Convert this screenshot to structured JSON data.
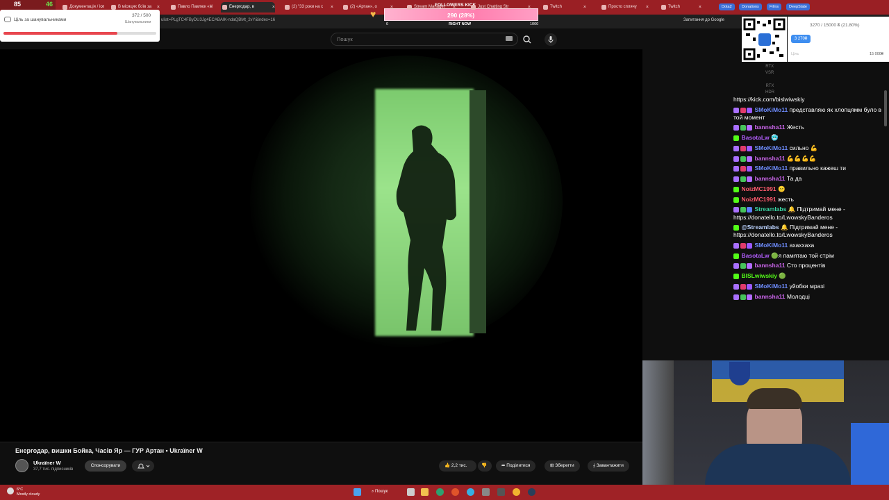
{
  "browser": {
    "tabs": [
      {
        "label": "Документація / історія"
      },
      {
        "label": "В місяцях боїв за"
      },
      {
        "label": "Павло Павлюк «Н"
      },
      {
        "label": "Енергодар, в"
      },
      {
        "label": "(2) \"33 роки на с"
      },
      {
        "label": "(2) «Артан», о"
      },
      {
        "label": "Stream Manager"
      },
      {
        "label": "Just Chatting Str"
      },
      {
        "label": "Twitch"
      },
      {
        "label": "Просто сплячу"
      },
      {
        "label": "Twitch"
      }
    ],
    "chips": [
      "Dota2",
      "Donations",
      "Films",
      "DeepState"
    ],
    "url": "ulist=PLgTC4FByDU3Jg4ECABAIK-ndaQBMt_2vY&index=16",
    "google_link": "Запитання до Google"
  },
  "youtube": {
    "search_placeholder": "Пошук",
    "video_title": "Енергодар, вишки Бойка, Часів Яр — ГУР Артан • Ukraїner W",
    "channel_name": "Ukraїner W",
    "channel_subs": "37,7 тис. підписників",
    "sponsor_label": "Спонсорувати",
    "like_count": "2,2 тис.",
    "share_label": "Поділитися",
    "save_label": "Зберегти",
    "download_label": "Завантажити"
  },
  "overlays": {
    "top_left_num": "85",
    "top_left_k": "46",
    "goal_title": "Ціль за шанувальниками",
    "goal_count": "372 / 500",
    "goal_sub": "Шанувальники",
    "goal_progress": 0.744,
    "followers_title": "FOLLOWERS KICK",
    "followers_value": "290 (28%)",
    "followers_min": "0",
    "followers_now": "RIGHT NOW",
    "followers_max": "1000",
    "donation_header": "3270 / 15000 ₴ (21.80%)",
    "donation_badge": "3 270₴",
    "donation_max": "15 000₴",
    "donation_min": "Ціль",
    "rtx_vsr": [
      "RTX",
      "VSR"
    ],
    "rtx_hdr": [
      "RTX",
      "HDR"
    ]
  },
  "chat": {
    "first_line": "https://kick.com/bislwiwskiy",
    "messages": [
      {
        "nick": "SMoKiMo11",
        "color": "#6f8dff",
        "text": "представляю як хлопцямм було в той момент",
        "badges": [
          "#a970ff",
          "#e03b6b",
          "#9b59ff"
        ]
      },
      {
        "nick": "bannsha11",
        "color": "#c864e8",
        "text": "Жесть",
        "badges": [
          "#a970ff",
          "#46c35a",
          "#b36cff"
        ]
      },
      {
        "nick": "BasotaLw",
        "color": "#b05dfa",
        "text": "🥶",
        "badges": [
          "#53fc18"
        ]
      },
      {
        "nick": "SMoKiMo11",
        "color": "#6f8dff",
        "text": "сильно 💪",
        "badges": [
          "#a970ff",
          "#e03b6b",
          "#9b59ff"
        ]
      },
      {
        "nick": "bannsha11",
        "color": "#c864e8",
        "text": "💪💪💪💪",
        "badges": [
          "#a970ff",
          "#46c35a",
          "#b36cff"
        ]
      },
      {
        "nick": "SMoKiMo11",
        "color": "#6f8dff",
        "text": "правильно кажеш ти",
        "badges": [
          "#a970ff",
          "#e03b6b",
          "#9b59ff"
        ]
      },
      {
        "nick": "bannsha11",
        "color": "#c864e8",
        "text": "Та да",
        "badges": [
          "#a970ff",
          "#46c35a",
          "#b36cff"
        ]
      },
      {
        "nick": "NoizMC1991",
        "color": "#ff5b6e",
        "text": "😑",
        "badges": [
          "#53fc18"
        ]
      },
      {
        "nick": "NoizMC1991",
        "color": "#ff5b6e",
        "text": "жесть",
        "badges": [
          "#53fc18"
        ]
      },
      {
        "nick": "Streamlabs",
        "color": "#3ad6a4",
        "text": "🔔 Підтримай мене - https://donatello.to/LwowskyBanderos",
        "badges": [
          "#a970ff",
          "#46c35a",
          "#5e7cff"
        ]
      },
      {
        "nick": "@Streamlabs",
        "color": "#bcd3ff",
        "text": "🔔 Підтримай мене - https://donatello.to/LwowskyBanderos",
        "badges": [
          "#53fc18"
        ]
      },
      {
        "nick": "SMoKiMo11",
        "color": "#6f8dff",
        "text": "ахаххаха",
        "badges": [
          "#a970ff",
          "#e03b6b",
          "#9b59ff"
        ]
      },
      {
        "nick": "BasotaLw",
        "color": "#b05dfa",
        "text": "🟢я памятаю той стрім",
        "badges": [
          "#53fc18"
        ]
      },
      {
        "nick": "bannsha11",
        "color": "#c864e8",
        "text": "Сто процентів",
        "badges": [
          "#a970ff",
          "#46c35a",
          "#b36cff"
        ]
      },
      {
        "nick": "BISLwiwskiy",
        "color": "#53fc18",
        "text": "🟢",
        "badges": [
          "#53fc18"
        ]
      },
      {
        "nick": "SMoKiMo11",
        "color": "#6f8dff",
        "text": "уйобки мразі",
        "badges": [
          "#a970ff",
          "#e03b6b",
          "#9b59ff"
        ]
      },
      {
        "nick": "bannsha11",
        "color": "#c864e8",
        "text": "Молодці",
        "badges": [
          "#a970ff",
          "#46c35a",
          "#b36cff"
        ]
      }
    ]
  },
  "taskbar": {
    "temp": "6°C",
    "weather": "Mostly cloudy",
    "search_label": "Пошук"
  }
}
